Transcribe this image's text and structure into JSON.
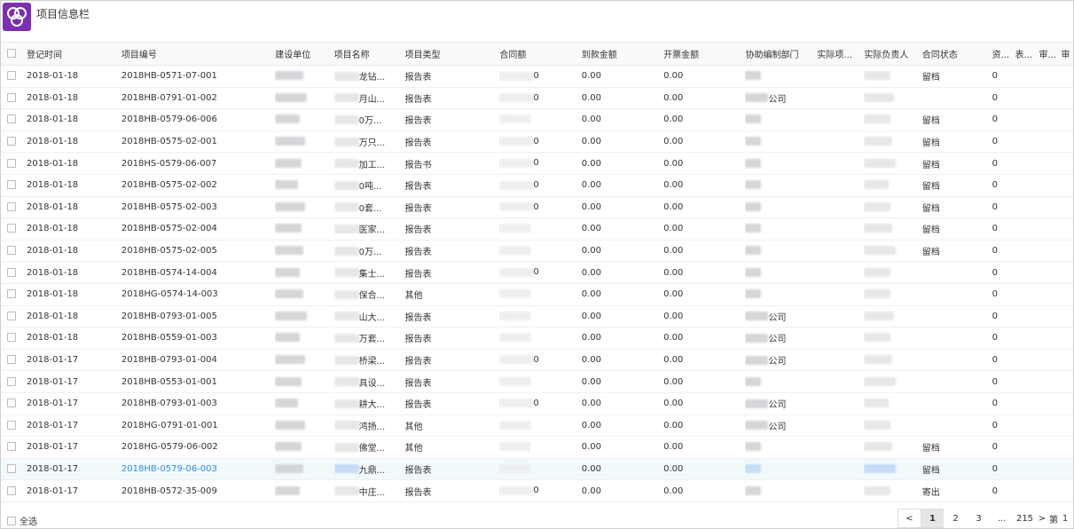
{
  "app": {
    "title": "项目信息栏"
  },
  "columns": [
    "登记时间",
    "项目编号",
    "建设单位",
    "项目名称",
    "项目类型",
    "合同额",
    "到款金额",
    "开票金额",
    "协助编制部门",
    "实际项...",
    "实际负责人",
    "合同状态",
    "资...",
    "表...",
    "审...",
    "审"
  ],
  "rows": [
    {
      "date": "2018-01-18",
      "code": "2018HB-0571-07-001",
      "name_tail": "龙钻...",
      "type": "报告表",
      "contract_tail": "0",
      "received": "0.00",
      "invoiced": "0.00",
      "dept_tail": "",
      "status": "留档",
      "zi": "0"
    },
    {
      "date": "2018-01-18",
      "code": "2018HB-0791-01-002",
      "name_tail": "月山...",
      "type": "报告表",
      "contract_tail": "0",
      "received": "0.00",
      "invoiced": "0.00",
      "dept_tail": "公司",
      "status": "",
      "zi": "0"
    },
    {
      "date": "2018-01-18",
      "code": "2018HB-0579-06-006",
      "name_tail": "0万...",
      "type": "报告表",
      "contract_tail": "",
      "received": "0.00",
      "invoiced": "0.00",
      "dept_tail": "",
      "status": "留档",
      "zi": "0"
    },
    {
      "date": "2018-01-18",
      "code": "2018HB-0575-02-001",
      "name_tail": "万只...",
      "type": "报告表",
      "contract_tail": "0",
      "received": "0.00",
      "invoiced": "0.00",
      "dept_tail": "",
      "status": "留档",
      "zi": "0"
    },
    {
      "date": "2018-01-18",
      "code": "2018HS-0579-06-007",
      "name_tail": "加工...",
      "type": "报告书",
      "contract_tail": "0",
      "received": "0.00",
      "invoiced": "0.00",
      "dept_tail": "",
      "status": "留档",
      "zi": "0"
    },
    {
      "date": "2018-01-18",
      "code": "2018HB-0575-02-002",
      "name_tail": "0吨...",
      "type": "报告表",
      "contract_tail": "0",
      "received": "0.00",
      "invoiced": "0.00",
      "dept_tail": "",
      "status": "留档",
      "zi": "0"
    },
    {
      "date": "2018-01-18",
      "code": "2018HB-0575-02-003",
      "name_tail": "0套...",
      "type": "报告表",
      "contract_tail": "0",
      "received": "0.00",
      "invoiced": "0.00",
      "dept_tail": "",
      "status": "留档",
      "zi": "0"
    },
    {
      "date": "2018-01-18",
      "code": "2018HB-0575-02-004",
      "name_tail": "医家...",
      "type": "报告表",
      "contract_tail": "",
      "received": "0.00",
      "invoiced": "0.00",
      "dept_tail": "",
      "status": "留档",
      "zi": "0"
    },
    {
      "date": "2018-01-18",
      "code": "2018HB-0575-02-005",
      "name_tail": "0万...",
      "type": "报告表",
      "contract_tail": "",
      "received": "0.00",
      "invoiced": "0.00",
      "dept_tail": "",
      "status": "留档",
      "zi": "0"
    },
    {
      "date": "2018-01-18",
      "code": "2018HB-0574-14-004",
      "name_tail": "集士...",
      "type": "报告表",
      "contract_tail": "0",
      "received": "0.00",
      "invoiced": "0.00",
      "dept_tail": "",
      "status": "",
      "zi": "0"
    },
    {
      "date": "2018-01-18",
      "code": "2018HG-0574-14-003",
      "name_tail": "保合...",
      "type": "其他",
      "contract_tail": "",
      "received": "0.00",
      "invoiced": "0.00",
      "dept_tail": "",
      "status": "",
      "zi": "0"
    },
    {
      "date": "2018-01-18",
      "code": "2018HB-0793-01-005",
      "name_tail": "山大...",
      "type": "报告表",
      "contract_tail": "",
      "received": "0.00",
      "invoiced": "0.00",
      "dept_tail": "公司",
      "status": "",
      "zi": "0"
    },
    {
      "date": "2018-01-18",
      "code": "2018HB-0559-01-003",
      "name_tail": "万套...",
      "type": "报告表",
      "contract_tail": "",
      "received": "0.00",
      "invoiced": "0.00",
      "dept_tail": "公司",
      "status": "",
      "zi": "0"
    },
    {
      "date": "2018-01-17",
      "code": "2018HB-0793-01-004",
      "name_tail": "桥梁...",
      "type": "报告表",
      "contract_tail": "0",
      "received": "0.00",
      "invoiced": "0.00",
      "dept_tail": "公司",
      "status": "",
      "zi": "0"
    },
    {
      "date": "2018-01-17",
      "code": "2018HB-0553-01-001",
      "name_tail": "具设...",
      "type": "报告表",
      "contract_tail": "",
      "received": "0.00",
      "invoiced": "0.00",
      "dept_tail": "",
      "status": "",
      "zi": "0"
    },
    {
      "date": "2018-01-17",
      "code": "2018HB-0793-01-003",
      "name_tail": "耕大...",
      "type": "报告表",
      "contract_tail": "0",
      "received": "0.00",
      "invoiced": "0.00",
      "dept_tail": "公司",
      "status": "",
      "zi": "0"
    },
    {
      "date": "2018-01-17",
      "code": "2018HG-0791-01-001",
      "name_tail": "鸿扬...",
      "type": "其他",
      "contract_tail": "",
      "received": "0.00",
      "invoiced": "0.00",
      "dept_tail": "公司",
      "status": "",
      "zi": "0"
    },
    {
      "date": "2018-01-17",
      "code": "2018HG-0579-06-002",
      "name_tail": "佛堂...",
      "type": "其他",
      "contract_tail": "",
      "received": "0.00",
      "invoiced": "0.00",
      "dept_tail": "",
      "status": "留档",
      "zi": "0"
    },
    {
      "date": "2018-01-17",
      "code": "2018HB-0579-06-003",
      "name_tail": "九鼎...",
      "type": "报告表",
      "contract_tail": "",
      "received": "0.00",
      "invoiced": "0.00",
      "dept_tail": "",
      "status": "留档",
      "zi": "0",
      "selected": true
    },
    {
      "date": "2018-01-17",
      "code": "2018HB-0572-35-009",
      "name_tail": "中庄...",
      "type": "报告表",
      "contract_tail": "0",
      "received": "0.00",
      "invoiced": "0.00",
      "dept_tail": "",
      "status": "寄出",
      "zi": "0"
    }
  ],
  "footer": {
    "select_all_label": "全选"
  },
  "pagination": {
    "prev": "<",
    "pages": [
      "1",
      "2",
      "3"
    ],
    "ellipsis": "...",
    "last_page": "215",
    "next": ">",
    "tail_label": "第",
    "tail_value": "1"
  }
}
